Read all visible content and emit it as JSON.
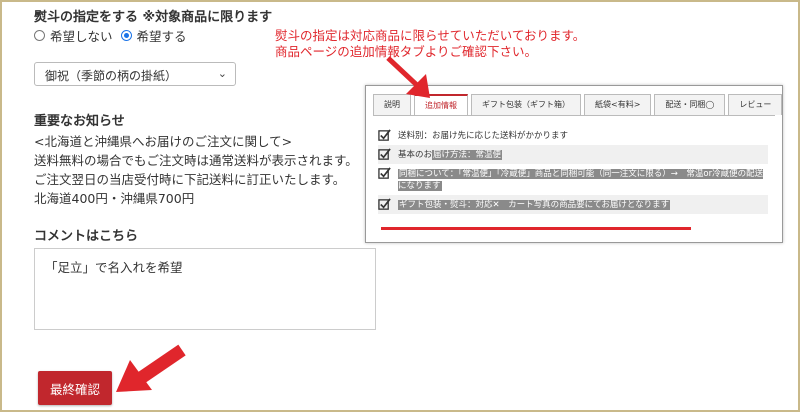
{
  "noshi": {
    "heading": "熨斗の指定をする ※対象商品に限ります",
    "options": [
      "希望しない",
      "希望する"
    ],
    "selected_index": 1,
    "select_value": "御祝（季節の柄の掛紙）"
  },
  "notice": {
    "title": "重要なお知らせ",
    "lines": [
      "<北海道と沖縄県へお届けのご注文に関して>",
      "送料無料の場合でもご注文時は通常送料が表示されます。",
      "ご注文翌日の当店受付時に下記送料に訂正いたします。",
      "北海道400円・沖縄県700円"
    ]
  },
  "comment": {
    "title": "コメントはこちら",
    "value": "「足立」で名入れを希望"
  },
  "submit_label": "最終確認",
  "annotation": {
    "line1": "熨斗の指定は対応商品に限らせていただいております。",
    "line2": "商品ページの追加情報タブよりご確認下さい。"
  },
  "panel": {
    "tabs": [
      "説明",
      "追加情報",
      "ギフト包装（ギフト箱）",
      "紙袋<有料>",
      "配送・同梱◯",
      "レビュー"
    ],
    "active_tab": 1,
    "rows": [
      {
        "plain": "送料別：お届け先に応じた送料がかかります",
        "hl": ""
      },
      {
        "plain": "基本のお",
        "hl": "届け方法：常温便"
      },
      {
        "plain": "",
        "hl": "同梱について：「常温便」「冷蔵便」商品と同梱可能（同一注文に限る）→　常温or冷蔵便の配送になります"
      },
      {
        "plain": "",
        "hl": "ギフト包装・熨斗：対応✕　カート写真の商品要にてお届けとなります"
      }
    ]
  },
  "colors": {
    "accent_red": "#c1272d",
    "annotation_red": "#e0262c",
    "radio_blue": "#1a73e8",
    "frame_gold": "#c9b98a"
  }
}
